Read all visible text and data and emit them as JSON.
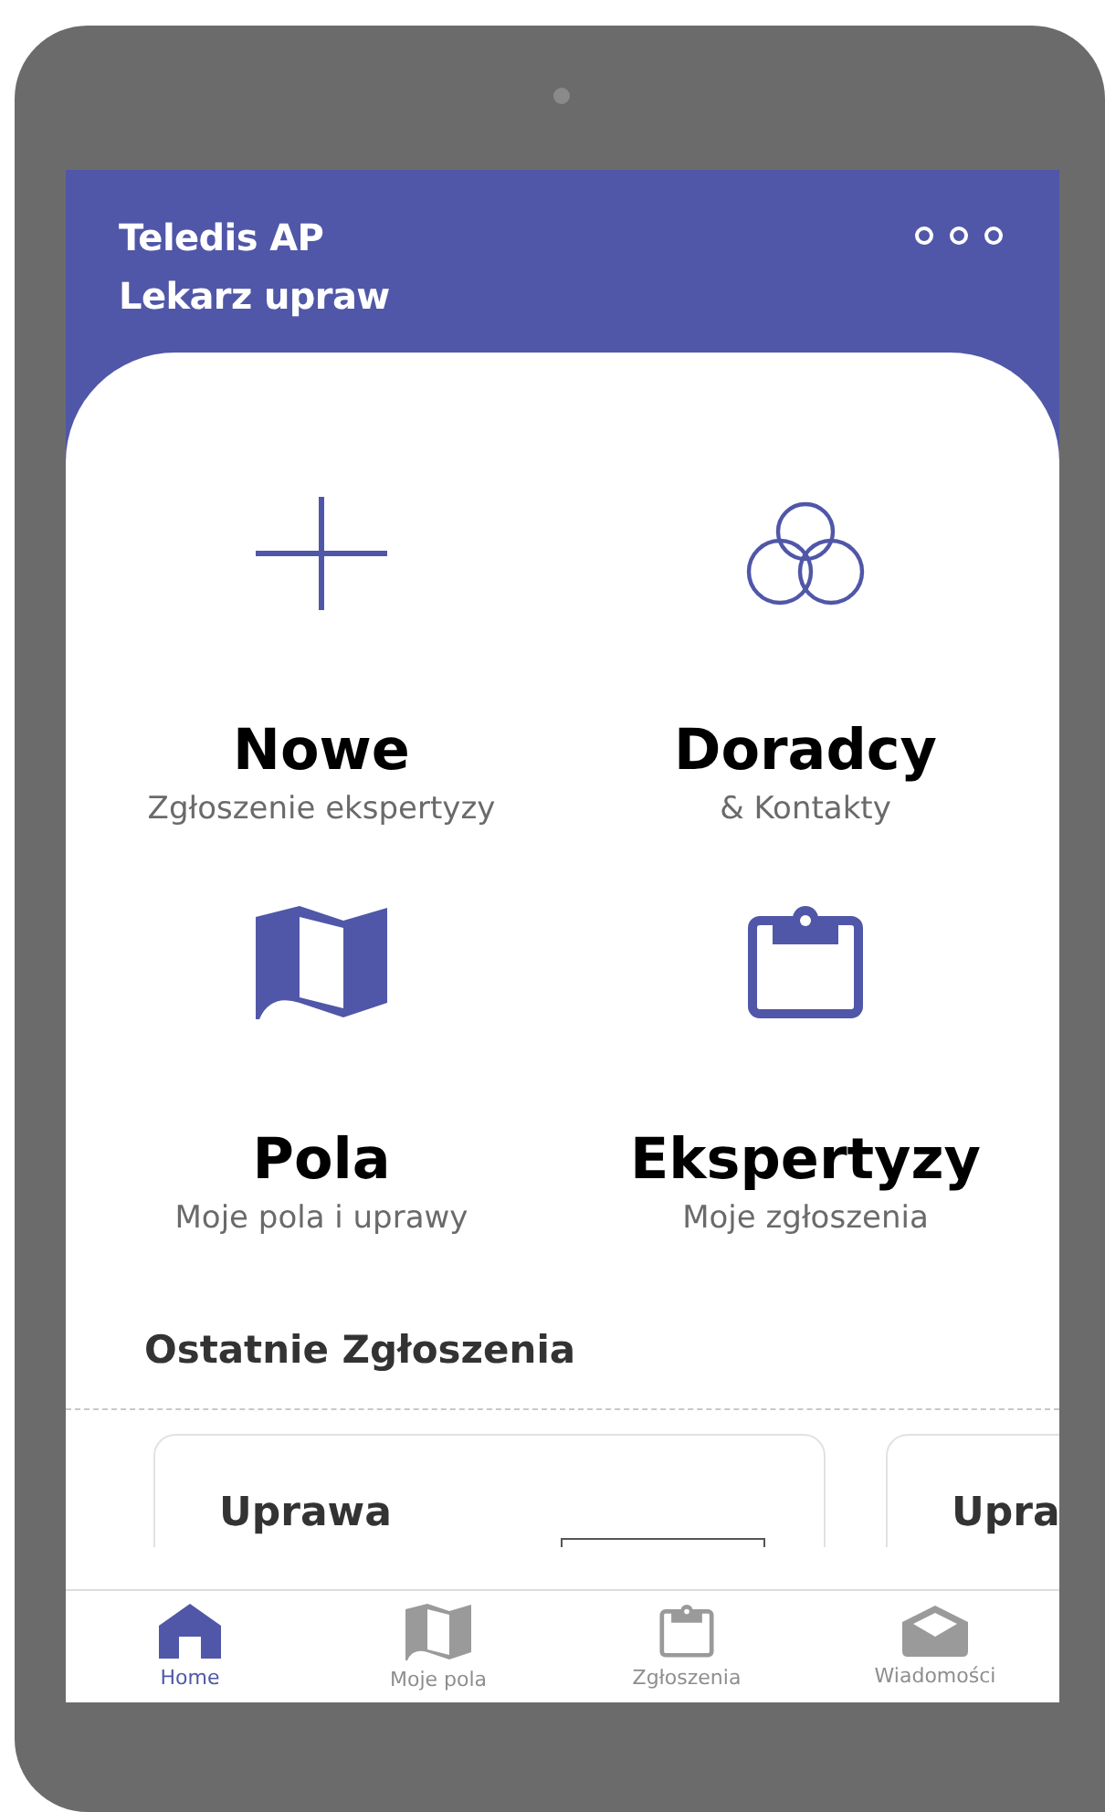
{
  "header": {
    "title": "Teledis AP",
    "subtitle": "Lekarz upraw"
  },
  "tiles": [
    {
      "kind": "plus",
      "title": "Nowe",
      "subtitle": "Zgłoszenie ekspertyzy"
    },
    {
      "kind": "circles",
      "title": "Doradcy",
      "subtitle": "& Kontakty"
    },
    {
      "kind": "map",
      "title": "Pola",
      "subtitle": "Moje pola i uprawy"
    },
    {
      "kind": "clipboard",
      "title": "Ekspertyzy",
      "subtitle": "Moje zgłoszenia"
    }
  ],
  "recent": {
    "title": "Ostatnie Zgłoszenia",
    "cards": [
      {
        "title": "Uprawa"
      },
      {
        "title": "Upra"
      }
    ]
  },
  "nav": [
    {
      "kind": "home",
      "label": "Home",
      "selected": true
    },
    {
      "kind": "map",
      "label": "Moje pola",
      "selected": false
    },
    {
      "kind": "clipboard",
      "label": "Zgłoszenia",
      "selected": false
    },
    {
      "kind": "mail",
      "label": "Wiadomości",
      "selected": false
    }
  ]
}
